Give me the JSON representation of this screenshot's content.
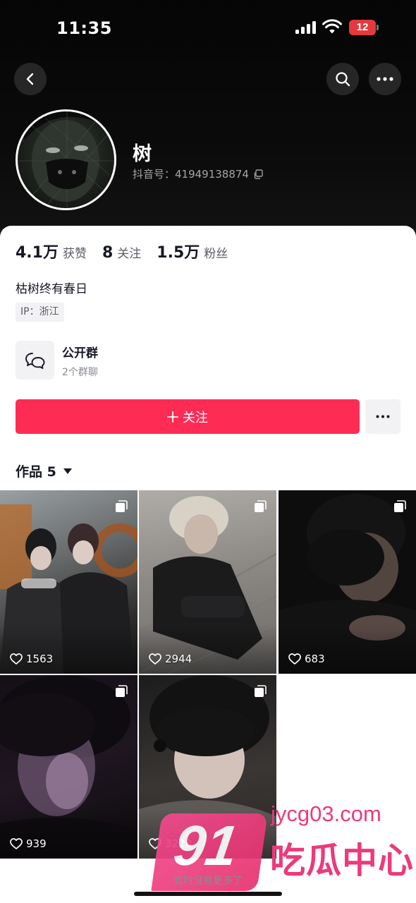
{
  "status_bar": {
    "time": "11:35",
    "battery": "12"
  },
  "profile": {
    "nickname": "树",
    "douyin_id": "抖音号：41949138874",
    "stats": [
      {
        "value": "4.1万",
        "label": "获赞"
      },
      {
        "value": "8",
        "label": "关注"
      },
      {
        "value": "1.5万",
        "label": "粉丝"
      }
    ],
    "bio": "枯树终有春日",
    "ip": "IP：浙江"
  },
  "group": {
    "title": "公开群",
    "subtitle": "2个群聊"
  },
  "actions": {
    "follow_label": "关注"
  },
  "works": {
    "tab_label": "作品 5",
    "items": [
      {
        "likes": "1563"
      },
      {
        "likes": "2944"
      },
      {
        "likes": "683"
      },
      {
        "likes": "939"
      },
      {
        "likes": "3228"
      }
    ],
    "footer": "暂时没有更多了"
  },
  "watermark": {
    "logo_number": "91",
    "site": "jycg03.com",
    "name": "吃瓜中心"
  },
  "colors": {
    "accent": "#fe2c55",
    "watermark": "#ec3a7c"
  }
}
